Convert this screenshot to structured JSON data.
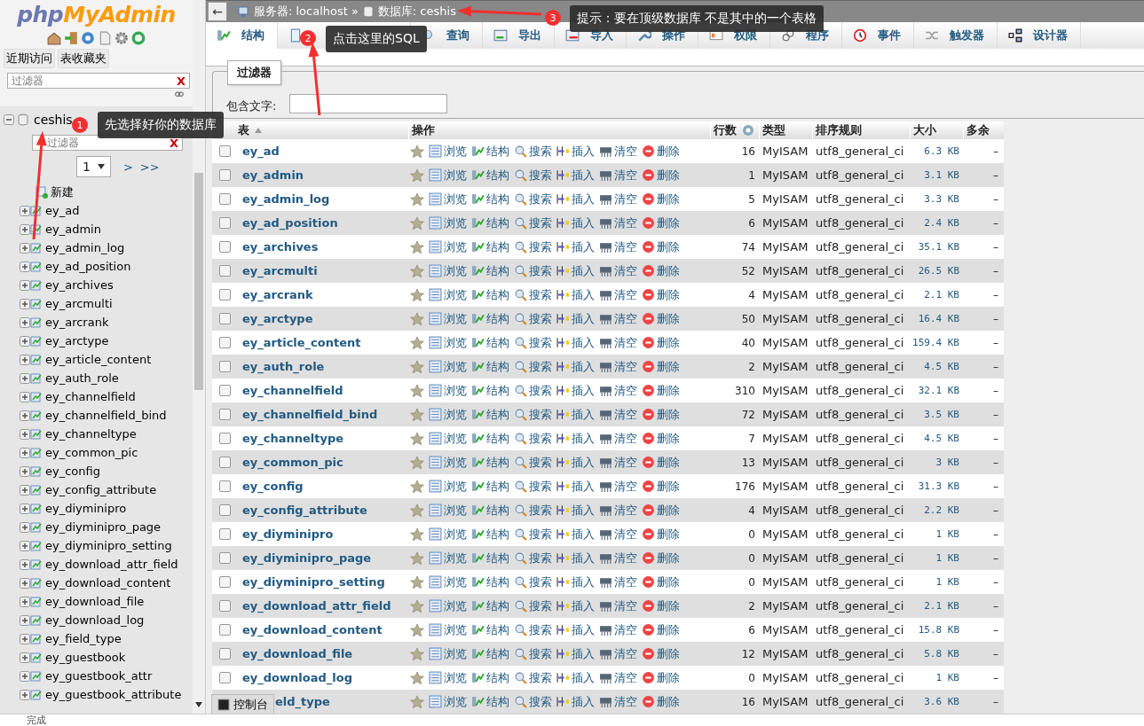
{
  "sidebar": {
    "logo": {
      "php": "php",
      "myadmin": "MyAdmin"
    },
    "buttons": [
      "近期访问",
      "表收藏夹"
    ],
    "filter": {
      "placeholder": "过滤器",
      "clear": "X"
    },
    "database": {
      "name": "ceshis",
      "expanded": true,
      "filter": {
        "placeholder": "过滤器",
        "clear": "X"
      },
      "page": "1",
      "pager": [
        ">",
        ">>"
      ],
      "new_item": "新建",
      "tables": [
        "ey_ad",
        "ey_admin",
        "ey_admin_log",
        "ey_ad_position",
        "ey_archives",
        "ey_arcmulti",
        "ey_arcrank",
        "ey_arctype",
        "ey_article_content",
        "ey_auth_role",
        "ey_channelfield",
        "ey_channelfield_bind",
        "ey_channeltype",
        "ey_common_pic",
        "ey_config",
        "ey_config_attribute",
        "ey_diyminipro",
        "ey_diyminipro_page",
        "ey_diyminipro_setting",
        "ey_download_attr_field",
        "ey_download_content",
        "ey_download_file",
        "ey_download_log",
        "ey_field_type",
        "ey_guestbook",
        "ey_guestbook_attr",
        "ey_guestbook_attribute"
      ]
    }
  },
  "breadcrumb": {
    "back": "←",
    "server": "服务器: localhost",
    "separator": "»",
    "database": "数据库: ceshis"
  },
  "tabs": [
    {
      "label": "结构",
      "selected": true
    },
    {
      "selected": false
    },
    {
      "label": "查询",
      "selected": false
    },
    {
      "label": "导出",
      "selected": false
    },
    {
      "label": "导入",
      "selected": false
    },
    {
      "label": "操作",
      "selected": false
    },
    {
      "label": "权限",
      "selected": false
    },
    {
      "label": "程序",
      "selected": false
    },
    {
      "label": "事件",
      "selected": false
    },
    {
      "label": "触发器",
      "selected": false
    },
    {
      "label": "设计器",
      "selected": false
    }
  ],
  "filter": {
    "legend": "过滤器",
    "label": "包含文字:"
  },
  "table": {
    "columns": [
      "表",
      "操作",
      "行数",
      "类型",
      "排序规则",
      "大小",
      "多余"
    ],
    "rows": [
      {
        "checked": false,
        "name": "ey_ad",
        "actions": [
          "浏览",
          "结构",
          "搜索",
          "插入",
          "清空",
          "删除"
        ],
        "rows": "16",
        "type": "MyISAM",
        "collation": "utf8_general_ci",
        "size": "6.3 KB",
        "overhead": "–"
      },
      {
        "checked": false,
        "name": "ey_admin",
        "actions": [
          "浏览",
          "结构",
          "搜索",
          "插入",
          "清空",
          "删除"
        ],
        "rows": "1",
        "type": "MyISAM",
        "collation": "utf8_general_ci",
        "size": "3.1 KB",
        "overhead": "–"
      },
      {
        "checked": false,
        "name": "ey_admin_log",
        "actions": [
          "浏览",
          "结构",
          "搜索",
          "插入",
          "清空",
          "删除"
        ],
        "rows": "5",
        "type": "MyISAM",
        "collation": "utf8_general_ci",
        "size": "3.3 KB",
        "overhead": "–"
      },
      {
        "checked": false,
        "name": "ey_ad_position",
        "actions": [
          "浏览",
          "结构",
          "搜索",
          "插入",
          "清空",
          "删除"
        ],
        "rows": "6",
        "type": "MyISAM",
        "collation": "utf8_general_ci",
        "size": "2.4 KB",
        "overhead": "–"
      },
      {
        "checked": false,
        "name": "ey_archives",
        "actions": [
          "浏览",
          "结构",
          "搜索",
          "插入",
          "清空",
          "删除"
        ],
        "rows": "74",
        "type": "MyISAM",
        "collation": "utf8_general_ci",
        "size": "35.1 KB",
        "overhead": "–"
      },
      {
        "checked": false,
        "name": "ey_arcmulti",
        "actions": [
          "浏览",
          "结构",
          "搜索",
          "插入",
          "清空",
          "删除"
        ],
        "rows": "52",
        "type": "MyISAM",
        "collation": "utf8_general_ci",
        "size": "26.5 KB",
        "overhead": "–"
      },
      {
        "checked": false,
        "name": "ey_arcrank",
        "actions": [
          "浏览",
          "结构",
          "搜索",
          "插入",
          "清空",
          "删除"
        ],
        "rows": "4",
        "type": "MyISAM",
        "collation": "utf8_general_ci",
        "size": "2.1 KB",
        "overhead": "–"
      },
      {
        "checked": false,
        "name": "ey_arctype",
        "actions": [
          "浏览",
          "结构",
          "搜索",
          "插入",
          "清空",
          "删除"
        ],
        "rows": "50",
        "type": "MyISAM",
        "collation": "utf8_general_ci",
        "size": "16.4 KB",
        "overhead": "–"
      },
      {
        "checked": false,
        "name": "ey_article_content",
        "actions": [
          "浏览",
          "结构",
          "搜索",
          "插入",
          "清空",
          "删除"
        ],
        "rows": "40",
        "type": "MyISAM",
        "collation": "utf8_general_ci",
        "size": "159.4 KB",
        "overhead": "–"
      },
      {
        "checked": false,
        "name": "ey_auth_role",
        "actions": [
          "浏览",
          "结构",
          "搜索",
          "插入",
          "清空",
          "删除"
        ],
        "rows": "2",
        "type": "MyISAM",
        "collation": "utf8_general_ci",
        "size": "4.5 KB",
        "overhead": "–"
      },
      {
        "checked": false,
        "name": "ey_channelfield",
        "actions": [
          "浏览",
          "结构",
          "搜索",
          "插入",
          "清空",
          "删除"
        ],
        "rows": "310",
        "type": "MyISAM",
        "collation": "utf8_general_ci",
        "size": "32.1 KB",
        "overhead": "–"
      },
      {
        "checked": false,
        "name": "ey_channelfield_bind",
        "actions": [
          "浏览",
          "结构",
          "搜索",
          "插入",
          "清空",
          "删除"
        ],
        "rows": "72",
        "type": "MyISAM",
        "collation": "utf8_general_ci",
        "size": "3.5 KB",
        "overhead": "–"
      },
      {
        "checked": false,
        "name": "ey_channeltype",
        "actions": [
          "浏览",
          "结构",
          "搜索",
          "插入",
          "清空",
          "删除"
        ],
        "rows": "7",
        "type": "MyISAM",
        "collation": "utf8_general_ci",
        "size": "4.5 KB",
        "overhead": "–"
      },
      {
        "checked": false,
        "name": "ey_common_pic",
        "actions": [
          "浏览",
          "结构",
          "搜索",
          "插入",
          "清空",
          "删除"
        ],
        "rows": "13",
        "type": "MyISAM",
        "collation": "utf8_general_ci",
        "size": "3 KB",
        "overhead": "–"
      },
      {
        "checked": false,
        "name": "ey_config",
        "actions": [
          "浏览",
          "结构",
          "搜索",
          "插入",
          "清空",
          "删除"
        ],
        "rows": "176",
        "type": "MyISAM",
        "collation": "utf8_general_ci",
        "size": "31.3 KB",
        "overhead": "–"
      },
      {
        "checked": false,
        "name": "ey_config_attribute",
        "actions": [
          "浏览",
          "结构",
          "搜索",
          "插入",
          "清空",
          "删除"
        ],
        "rows": "4",
        "type": "MyISAM",
        "collation": "utf8_general_ci",
        "size": "2.2 KB",
        "overhead": "–"
      },
      {
        "checked": false,
        "name": "ey_diyminipro",
        "actions": [
          "浏览",
          "结构",
          "搜索",
          "插入",
          "清空",
          "删除"
        ],
        "rows": "0",
        "type": "MyISAM",
        "collation": "utf8_general_ci",
        "size": "1 KB",
        "overhead": "–"
      },
      {
        "checked": false,
        "name": "ey_diyminipro_page",
        "actions": [
          "浏览",
          "结构",
          "搜索",
          "插入",
          "清空",
          "删除"
        ],
        "rows": "0",
        "type": "MyISAM",
        "collation": "utf8_general_ci",
        "size": "1 KB",
        "overhead": "–"
      },
      {
        "checked": false,
        "name": "ey_diyminipro_setting",
        "actions": [
          "浏览",
          "结构",
          "搜索",
          "插入",
          "清空",
          "删除"
        ],
        "rows": "0",
        "type": "MyISAM",
        "collation": "utf8_general_ci",
        "size": "1 KB",
        "overhead": "–"
      },
      {
        "checked": false,
        "name": "ey_download_attr_field",
        "actions": [
          "浏览",
          "结构",
          "搜索",
          "插入",
          "清空",
          "删除"
        ],
        "rows": "2",
        "type": "MyISAM",
        "collation": "utf8_general_ci",
        "size": "2.1 KB",
        "overhead": "–"
      },
      {
        "checked": false,
        "name": "ey_download_content",
        "actions": [
          "浏览",
          "结构",
          "搜索",
          "插入",
          "清空",
          "删除"
        ],
        "rows": "6",
        "type": "MyISAM",
        "collation": "utf8_general_ci",
        "size": "15.8 KB",
        "overhead": "–"
      },
      {
        "checked": false,
        "name": "ey_download_file",
        "actions": [
          "浏览",
          "结构",
          "搜索",
          "插入",
          "清空",
          "删除"
        ],
        "rows": "12",
        "type": "MyISAM",
        "collation": "utf8_general_ci",
        "size": "5.8 KB",
        "overhead": "–"
      },
      {
        "checked": false,
        "name": "ey_download_log",
        "actions": [
          "浏览",
          "结构",
          "搜索",
          "插入",
          "清空",
          "删除"
        ],
        "rows": "0",
        "type": "MyISAM",
        "collation": "utf8_general_ci",
        "size": "1 KB",
        "overhead": "–"
      },
      {
        "name": "eld_type",
        "actions": [
          "浏览",
          "结构",
          "搜索",
          "插入",
          "清空",
          "删除"
        ],
        "rows": "16",
        "type": "MyISAM",
        "collation": "utf8_general_ci",
        "size": "3.6 KB",
        "overhead": "–"
      }
    ]
  },
  "console": {
    "label": "控制台"
  },
  "status_bar": {
    "text": "完成"
  },
  "annotations": [
    {
      "number": "1",
      "text": "先选择好你的数据库"
    },
    {
      "number": "2",
      "text": "点击这里的SQL"
    },
    {
      "number": "3",
      "text": "提示：要在顶级数据库 不是其中的一个表格"
    }
  ]
}
